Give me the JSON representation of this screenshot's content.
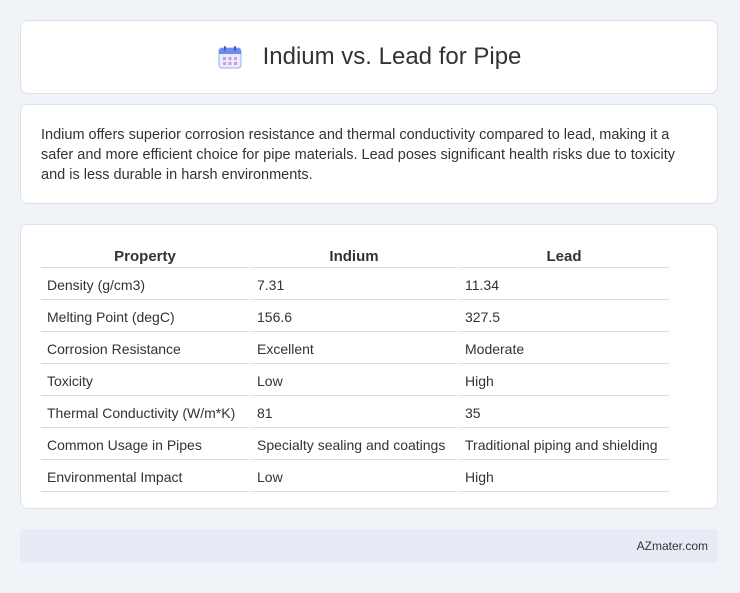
{
  "header": {
    "title": "Indium vs. Lead for Pipe",
    "icon": "calendar-icon"
  },
  "summary": {
    "text": "Indium offers superior corrosion resistance and thermal conductivity compared to lead, making it a safer and more efficient choice for pipe materials. Lead poses significant health risks due to toxicity and is less durable in harsh environments."
  },
  "table": {
    "headers": [
      "Property",
      "Indium",
      "Lead"
    ],
    "rows": [
      [
        "Density (g/cm3)",
        "7.31",
        "11.34"
      ],
      [
        "Melting Point (degC)",
        "156.6",
        "327.5"
      ],
      [
        "Corrosion Resistance",
        "Excellent",
        "Moderate"
      ],
      [
        "Toxicity",
        "Low",
        "High"
      ],
      [
        "Thermal Conductivity (W/m*K)",
        "81",
        "35"
      ],
      [
        "Common Usage in Pipes",
        "Specialty sealing and coatings",
        "Traditional piping and shielding"
      ],
      [
        "Environmental Impact",
        "Low",
        "High"
      ]
    ]
  },
  "footer": {
    "brand": "AZmater.com"
  },
  "colors": {
    "page_background": "#f0f3f8",
    "card_background": "#ffffff",
    "footer_background": "#e6ebf5",
    "icon_accent": "#6c8cf0"
  }
}
